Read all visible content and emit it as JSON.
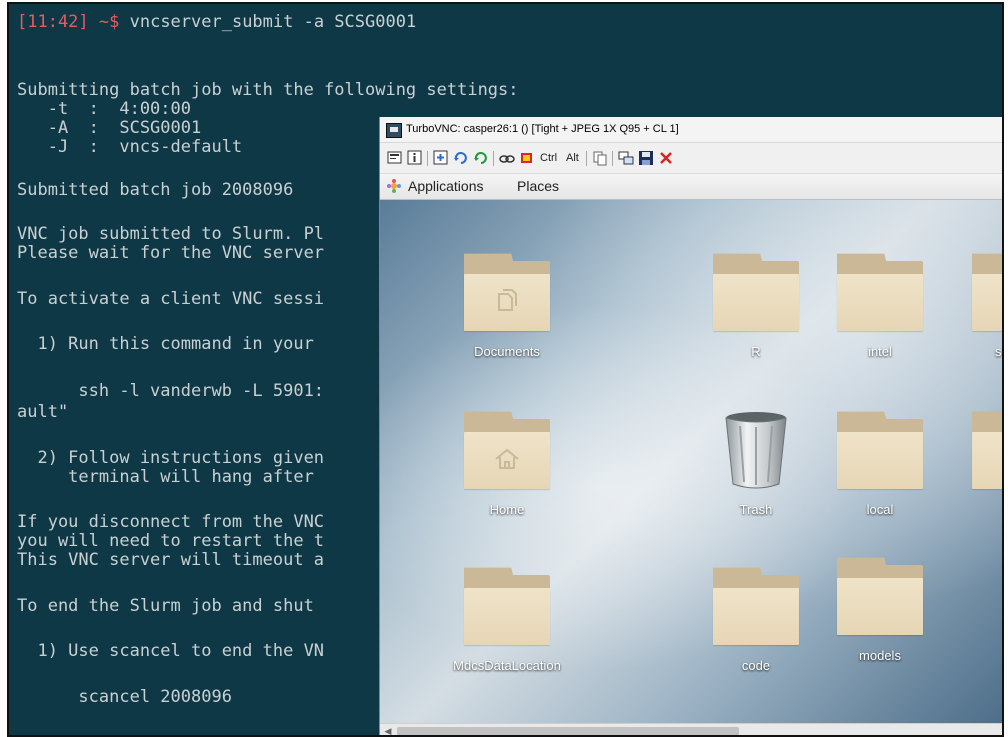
{
  "terminal": {
    "prompt_time": "[11:42]",
    "prompt_cwd": " ~$ ",
    "command": "vncserver_submit -a SCSG0001",
    "lines": [
      "Submitting batch job with the following settings:",
      "   -t  :  4:00:00",
      "   -A  :  SCSG0001",
      "   -J  :  vncs-default",
      "Submitted batch job 2008096",
      "VNC job submitted to Slurm. Pl",
      "Please wait for the VNC server",
      "To activate a client VNC sessi",
      "  1) Run this command in your ",
      "      ssh -l vanderwb -L 5901:",
      "ault\"",
      "  2) Follow instructions given",
      "     terminal will hang after ",
      "If you disconnect from the VNC",
      "you will need to restart the t",
      "This VNC server will timeout a",
      "To end the Slurm job and shut ",
      "  1) Use scancel to end the VN",
      "      scancel 2008096"
    ]
  },
  "vnc": {
    "title": "TurboVNC: casper26:1 () [Tight + JPEG 1X Q95 + CL 1]",
    "toolbar": {
      "ctrl_label": "Ctrl",
      "alt_label": "Alt",
      "close_color": "#e02020"
    },
    "gnome": {
      "applications": "Applications",
      "places": "Places"
    },
    "desktop": {
      "icons": [
        {
          "label": "Documents",
          "type": "folder-documents"
        },
        {
          "label": "R",
          "type": "folder"
        },
        {
          "label": "intel",
          "type": "folder"
        },
        {
          "label": "s",
          "type": "folder"
        },
        {
          "label": "Home",
          "type": "folder-home"
        },
        {
          "label": "Trash",
          "type": "trash"
        },
        {
          "label": "local",
          "type": "folder"
        },
        {
          "label": "",
          "type": "folder"
        },
        {
          "label": "MdcsDataLocation",
          "type": "folder"
        },
        {
          "label": "code",
          "type": "folder"
        },
        {
          "label": "models",
          "type": "folder"
        }
      ]
    }
  },
  "colors": {
    "terminal_bg": "#0f3846",
    "terminal_fg": "#c8d0d2",
    "prompt": "#e85a63",
    "folder_front": "#efe3c8",
    "folder_back": "#cbb897"
  }
}
